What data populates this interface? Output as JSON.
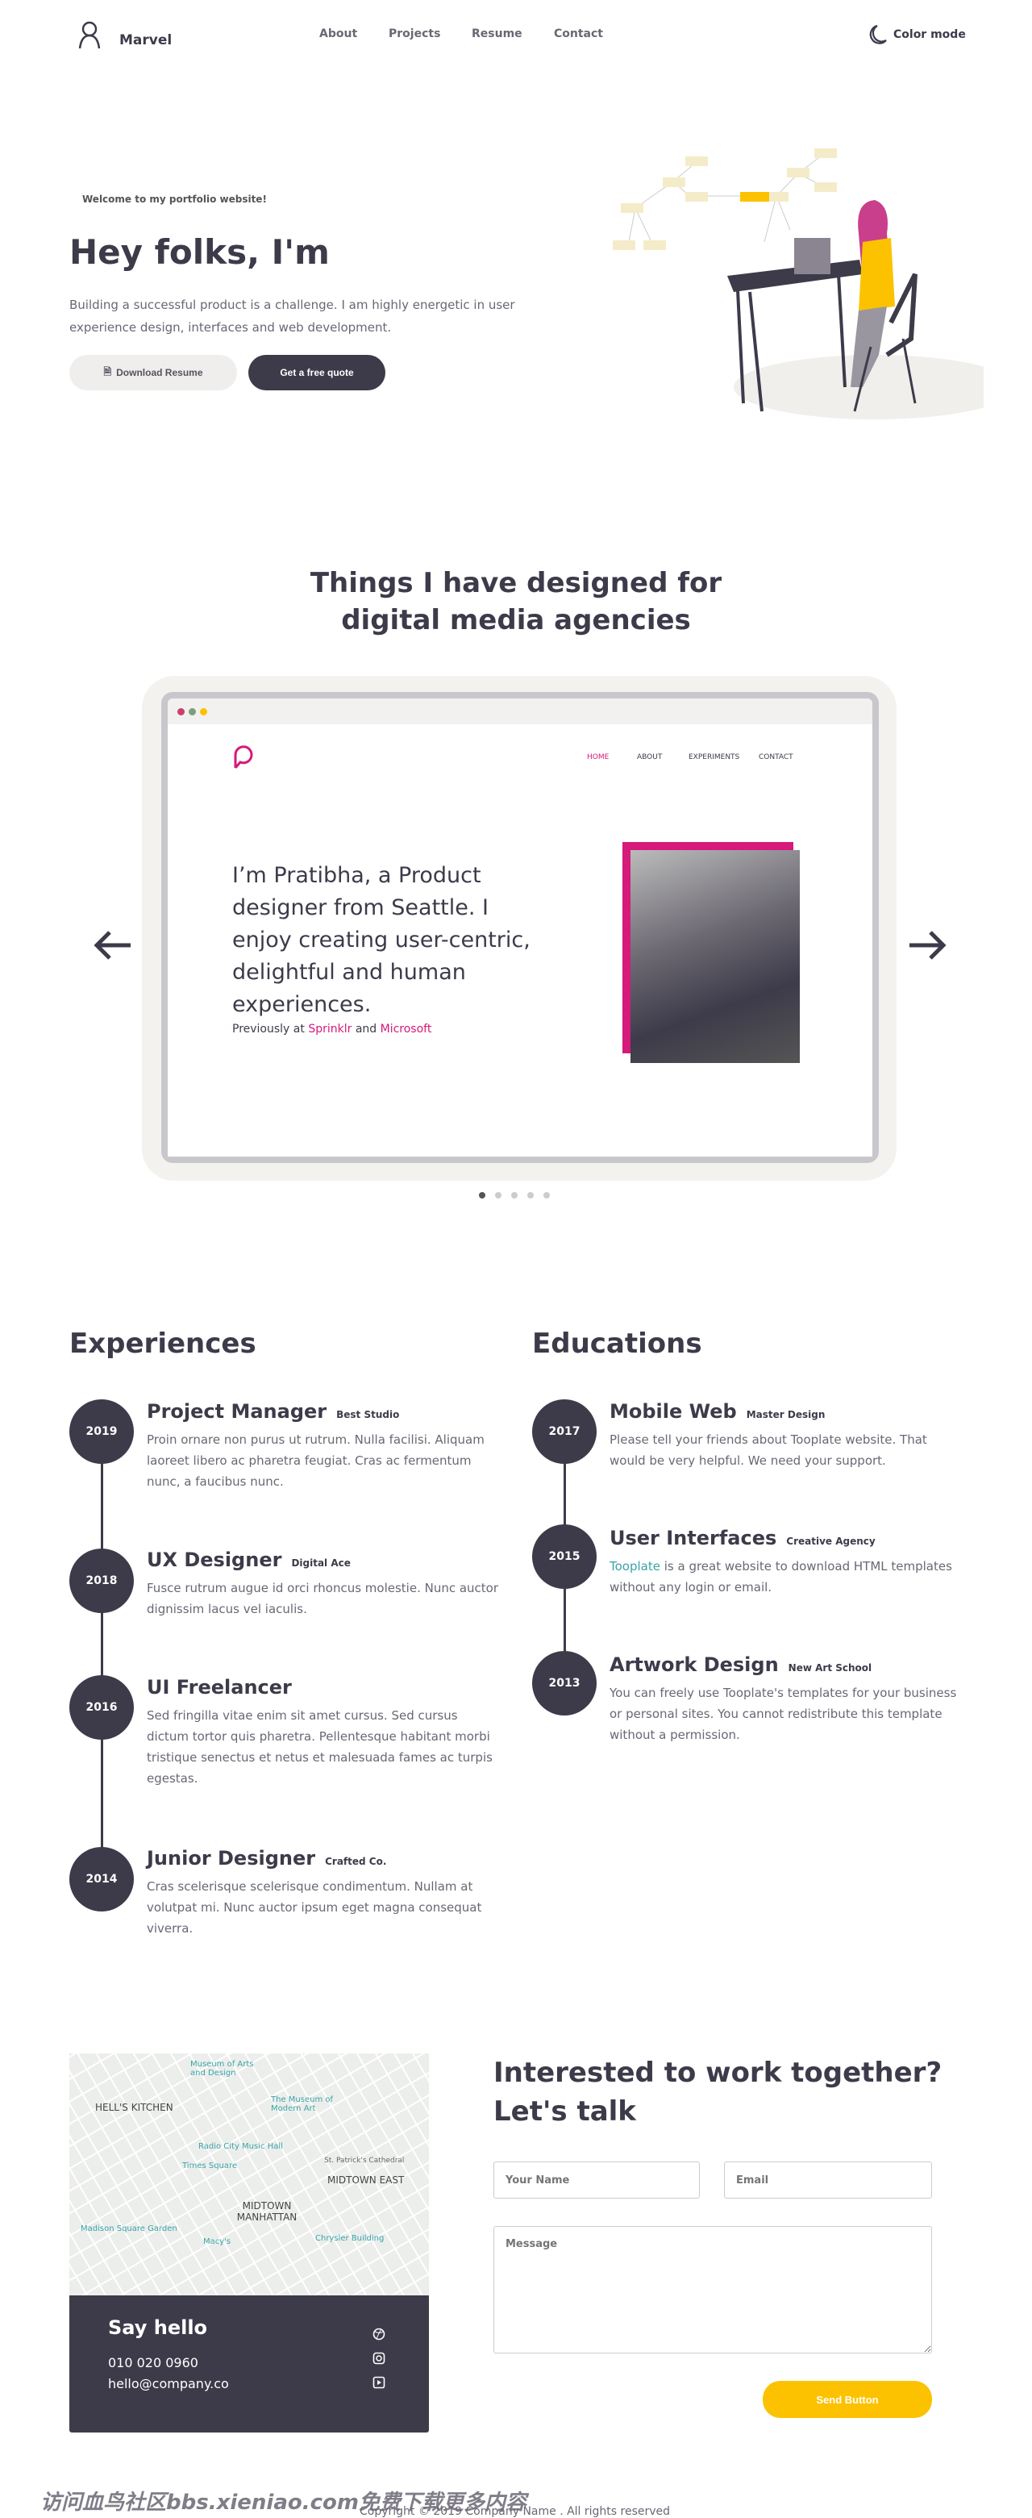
{
  "header": {
    "brand": "Marvel",
    "nav": [
      "About",
      "Projects",
      "Resume",
      "Contact"
    ],
    "color_mode": "Color mode"
  },
  "hero": {
    "welcome": "Welcome to my portfolio website!",
    "title": "Hey folks, I'm",
    "text": "Building a successful product is a challenge. I am highly energetic in user experience design, interfaces and web development.",
    "download": "Download Resume",
    "quote": "Get a free quote"
  },
  "projects": {
    "title": "Things I have designed for digital media agencies",
    "slide": {
      "nav": [
        "HOME",
        "ABOUT",
        "EXPERIMENTS",
        "CONTACT"
      ],
      "headline": "I’m Pratibha, a Product designer from Seattle. I enjoy creating user-centric, delightful and human experiences.",
      "prev": "Previously at",
      "company1": "Sprinklr",
      "and": "and",
      "company2": "Microsoft"
    },
    "slide_count": 5,
    "active_slide": 1
  },
  "experiences": {
    "title": "Experiences",
    "items": [
      {
        "year": "2019",
        "role": "Project Manager",
        "org": "Best Studio",
        "text": "Proin ornare non purus ut rutrum. Nulla facilisi. Aliquam laoreet libero ac pharetra feugiat. Cras ac fermentum nunc, a faucibus nunc."
      },
      {
        "year": "2018",
        "role": "UX Designer",
        "org": "Digital Ace",
        "text": "Fusce rutrum augue id orci rhoncus molestie. Nunc auctor dignissim lacus vel iaculis."
      },
      {
        "year": "2016",
        "role": "UI Freelancer",
        "org": "",
        "text": "Sed fringilla vitae enim sit amet cursus. Sed cursus dictum tortor quis pharetra. Pellentesque habitant morbi tristique senectus et netus et malesuada fames ac turpis egestas."
      },
      {
        "year": "2014",
        "role": "Junior Designer",
        "org": "Crafted Co.",
        "text": "Cras scelerisque scelerisque condimentum. Nullam at volutpat mi. Nunc auctor ipsum eget magna consequat viverra."
      }
    ]
  },
  "educations": {
    "title": "Educations",
    "items": [
      {
        "year": "2017",
        "role": "Mobile Web",
        "org": "Master Design",
        "text": "Please tell your friends about Tooplate website. That would be very helpful. We need your support."
      },
      {
        "year": "2015",
        "role": "User Interfaces",
        "org": "Creative Agency",
        "link": "Tooplate",
        "text": " is a great website to download HTML templates without any login or email."
      },
      {
        "year": "2013",
        "role": "Artwork Design",
        "org": "New Art School",
        "text": "You can freely use Tooplate's templates for your business or personal sites. You cannot redistribute this template without a permission."
      }
    ]
  },
  "contact": {
    "map_labels": [
      "HELL'S KITCHEN",
      "MIDTOWN EAST",
      "MIDTOWN MANHATTAN",
      "Times Square",
      "Radio City Music Hall",
      "The Museum of Modern Art",
      "St. Patrick's Cathedral",
      "Madison Square Garden",
      "Macy's",
      "Chrysler Building",
      "Museum of Arts and Design"
    ],
    "say_hello": "Say hello",
    "phone": "010 020 0960",
    "email": "hello@company.co",
    "title": "Interested to work together? Let's talk",
    "name_ph": "Your Name",
    "email_ph": "Email",
    "message_ph": "Message",
    "send": "Send Button"
  },
  "watermark": "访问血鸟社区bbs.xieniao.com免费下载更多内容",
  "footer": {
    "copyright": "Copyright © 2019 Company Name . All rights reserved"
  },
  "colors": {
    "dark": "#3d3b4a",
    "accent": "#fcc200",
    "pink": "#d6197a",
    "teal": "#3aa3a8"
  }
}
